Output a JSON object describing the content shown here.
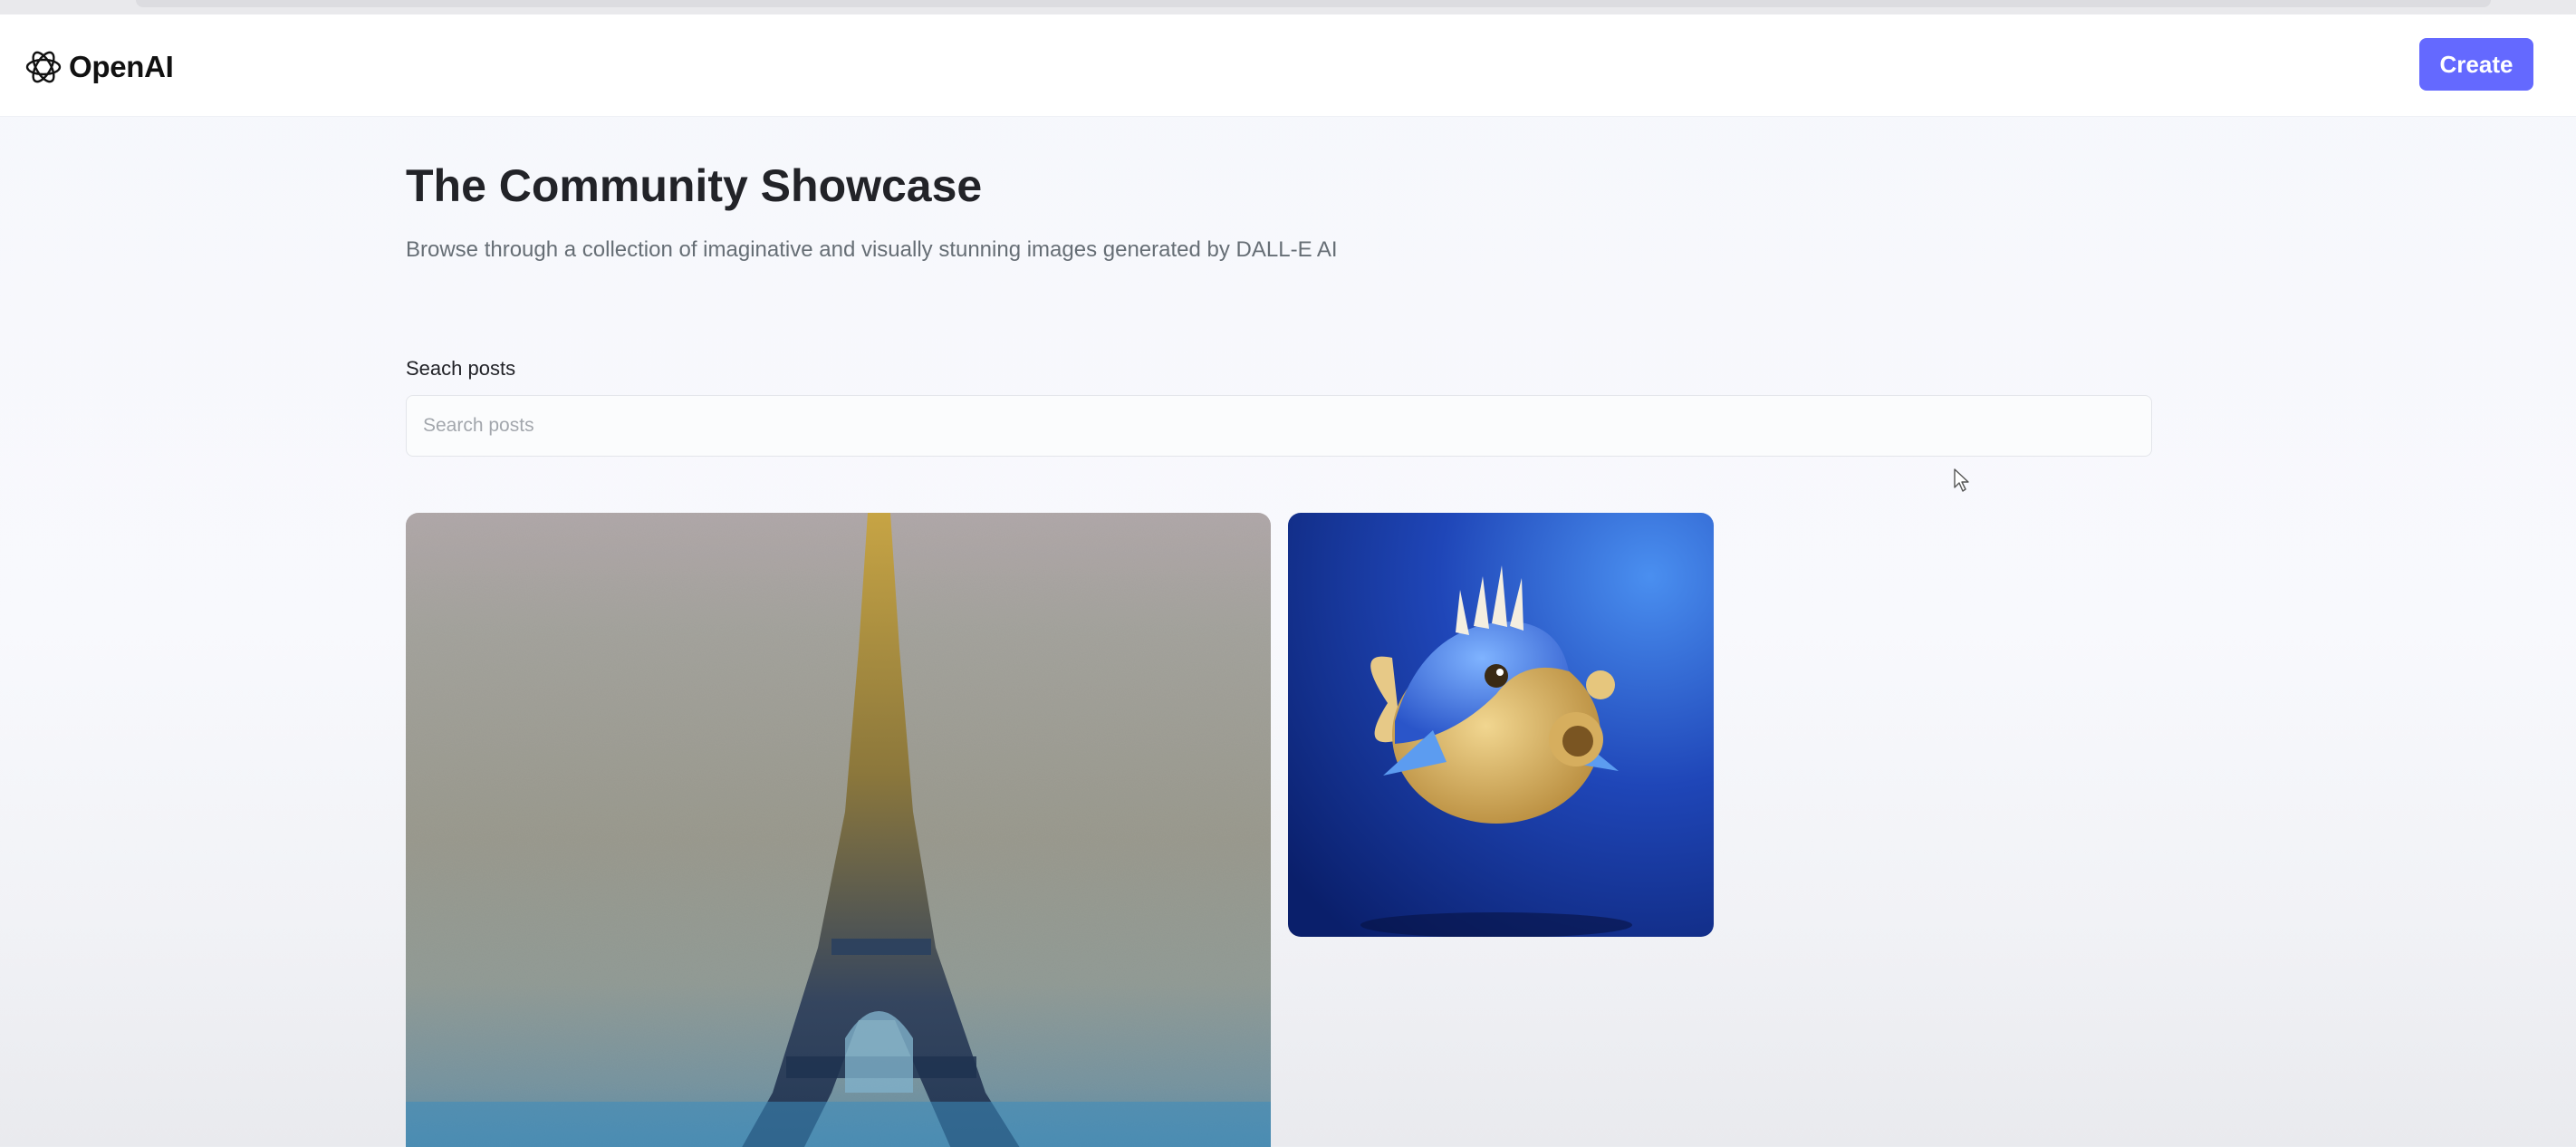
{
  "header": {
    "logo_text": "OpenAI",
    "create_label": "Create"
  },
  "main": {
    "title": "The Community Showcase",
    "subtitle": "Browse through a collection of imaginative and visually stunning images generated by DALL-E AI"
  },
  "search": {
    "label": "Seach posts",
    "placeholder": "Search posts",
    "value": ""
  },
  "gallery": {
    "cards": [
      {
        "subject": "eiffel-tower-painting"
      },
      {
        "subject": "blue-fish-render"
      }
    ]
  },
  "colors": {
    "accent": "#6469ff",
    "title": "#222328",
    "subtitle": "#666e75",
    "background": "#f6f7fc"
  }
}
